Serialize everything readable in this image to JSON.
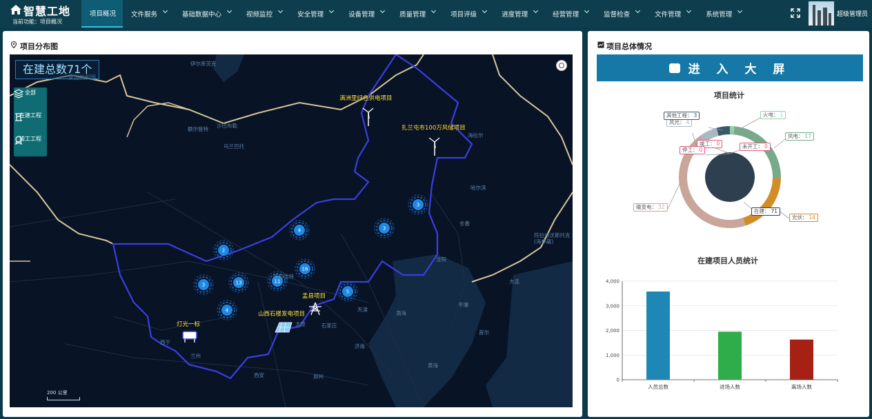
{
  "brand": {
    "title": "智慧工地",
    "crumb_label": "当前功能：",
    "crumb_value": "项目概况"
  },
  "nav": [
    {
      "label": "项目概况",
      "active": true
    },
    {
      "label": "文件服务"
    },
    {
      "label": "基础数据中心"
    },
    {
      "label": "视频监控"
    },
    {
      "label": "安全管理"
    },
    {
      "label": "设备管理"
    },
    {
      "label": "质量管理"
    },
    {
      "label": "项目评级"
    },
    {
      "label": "进度管理"
    },
    {
      "label": "经营管理"
    },
    {
      "label": "监督检查"
    },
    {
      "label": "文件管理"
    },
    {
      "label": "系统管理"
    }
  ],
  "user": {
    "name": "超级管理员"
  },
  "left": {
    "title": "项目分布图",
    "total": "在建总数71个",
    "country_label": "蒙古共和国",
    "layers": {
      "all": "全部",
      "building": "在建工程",
      "done": "竣工工程"
    },
    "scale": "200 公里",
    "projects": [
      {
        "name": "满洲里绿色供电项目"
      },
      {
        "name": "扎兰屯市100万风储项目"
      },
      {
        "name": "灯光一标"
      },
      {
        "name": "山西石楼发电项目"
      },
      {
        "name": "盂县项目"
      }
    ],
    "clusters": [
      "3",
      "3",
      "4",
      "2",
      "16",
      "11",
      "13",
      "3",
      "5",
      "4"
    ],
    "places": [
      "乌兰巴托",
      "哈尔滨",
      "长春",
      "沈阳",
      "天津",
      "石家庄",
      "太原",
      "呼和浩特",
      "西宁",
      "兰州",
      "西安",
      "郑州",
      "济南",
      "渤海",
      "黄海",
      "首尔",
      "平壤",
      "大连",
      "海拉尔",
      "沙巴布勒",
      "额尔登特",
      "伊尔库茨克",
      "符拉迪沃斯托克(海参崴)"
    ],
    "colors": {
      "map_bg": "#081326",
      "border": "#3b3fe0",
      "intl_border": "#d8c79a",
      "cluster": "#1e88e5",
      "label": "#ffe94a"
    }
  },
  "right": {
    "title": "项目总体情况",
    "bigscreen": "进 入 大 屏",
    "pie_title": "项目统计",
    "bar_title": "在建项目人员统计"
  },
  "chart_data": [
    {
      "type": "pie",
      "title": "项目统计",
      "inner": [
        {
          "name": "在建",
          "value": 71,
          "color": "#2e4050"
        },
        {
          "name": "未开工",
          "value": 0
        },
        {
          "name": "竣工",
          "value": 0
        },
        {
          "name": "停工",
          "value": 0
        }
      ],
      "outer": [
        {
          "name": "火电",
          "value": 1,
          "color": "#8fd1a8"
        },
        {
          "name": "风电",
          "value": 17,
          "color": "#78a98a"
        },
        {
          "name": "光伏",
          "value": 14,
          "color": "#d18d28"
        },
        {
          "name": "输变电",
          "value": 32,
          "color": "#c8a69a"
        },
        {
          "name": "风光",
          "value": 4,
          "color": "#a8b9c4"
        },
        {
          "name": "其他工程",
          "value": 3,
          "color": "#3b5868"
        }
      ]
    },
    {
      "type": "bar",
      "title": "在建项目人员统计",
      "categories": [
        "人员总数",
        "进场人数",
        "离场人数"
      ],
      "values": [
        3580,
        1950,
        1630
      ],
      "colors": [
        "#1f87b5",
        "#2fad4a",
        "#a62014"
      ],
      "ylim": [
        0,
        4000
      ],
      "yticks": [
        "0",
        "1,000",
        "2,000",
        "3,000",
        "4,000"
      ]
    }
  ]
}
